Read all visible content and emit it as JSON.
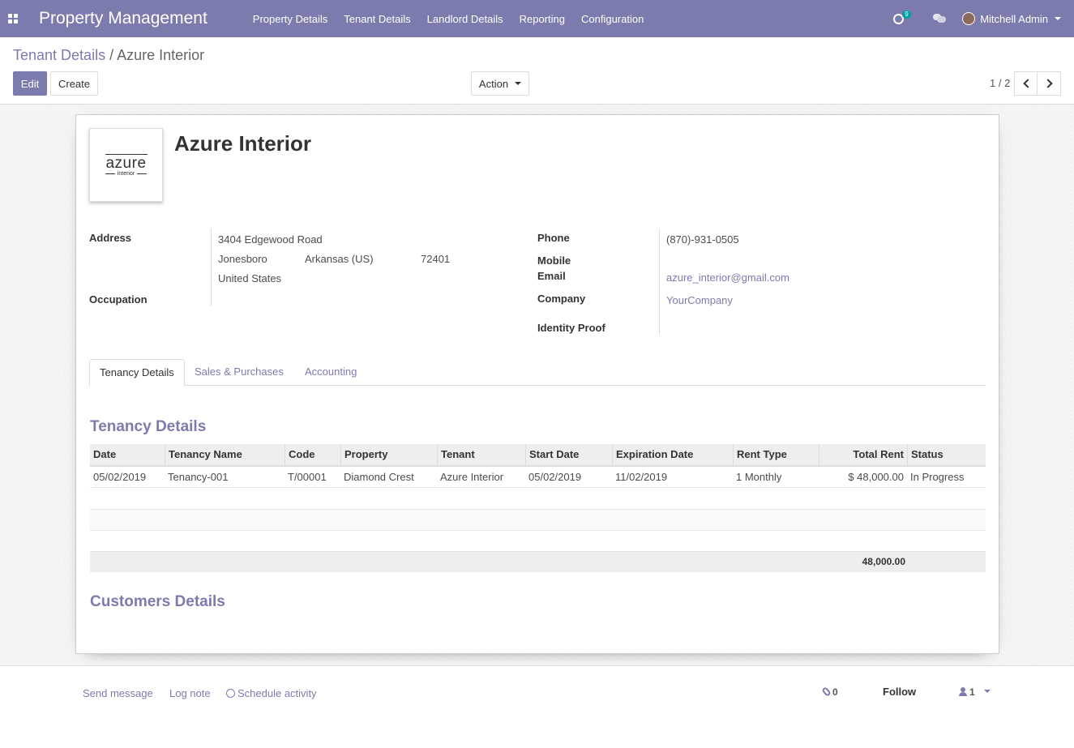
{
  "navbar": {
    "app_title": "Property Management",
    "menu": [
      "Property Details",
      "Tenant Details",
      "Landlord Details",
      "Reporting",
      "Configuration"
    ],
    "activity_count": "9",
    "user_name": "Mitchell Admin"
  },
  "control": {
    "breadcrumb_parent": "Tenant Details",
    "breadcrumb_sep": "/",
    "breadcrumb_current": "Azure Interior",
    "edit_label": "Edit",
    "create_label": "Create",
    "action_label": "Action",
    "pager": "1 / 2"
  },
  "record": {
    "logo_word": "azure",
    "logo_sub": "interior",
    "name": "Azure Interior",
    "address_label": "Address",
    "street": "3404 Edgewood Road",
    "city": "Jonesboro",
    "state": "Arkansas (US)",
    "zip": "72401",
    "country": "United States",
    "occupation_label": "Occupation",
    "phone_label": "Phone",
    "phone": "(870)-931-0505",
    "mobile_label": "Mobile",
    "email_label": "Email",
    "email": "azure_interior@gmail.com",
    "company_label": "Company",
    "company": "YourCompany",
    "identity_label": "Identity Proof"
  },
  "tabs": [
    "Tenancy Details",
    "Sales & Purchases",
    "Accounting"
  ],
  "tenancy": {
    "title": "Tenancy Details",
    "columns": [
      "Date",
      "Tenancy Name",
      "Code",
      "Property",
      "Tenant",
      "Start Date",
      "Expiration Date",
      "Rent Type",
      "Total Rent",
      "Status"
    ],
    "rows": [
      [
        "05/02/2019",
        "Tenancy-001",
        "T/00001",
        "Diamond Crest",
        "Azure Interior",
        "05/02/2019",
        "11/02/2019",
        "1 Monthly",
        "$ 48,000.00",
        "In Progress"
      ]
    ],
    "total": "48,000.00"
  },
  "customers_title": "Customers Details",
  "chatter": {
    "send_message": "Send message",
    "log_note": "Log note",
    "schedule_activity": "Schedule activity",
    "attachments": "0",
    "follow": "Follow",
    "followers": "1"
  },
  "colors": {
    "brand": "#7c7bad",
    "teal": "#00a09d"
  }
}
